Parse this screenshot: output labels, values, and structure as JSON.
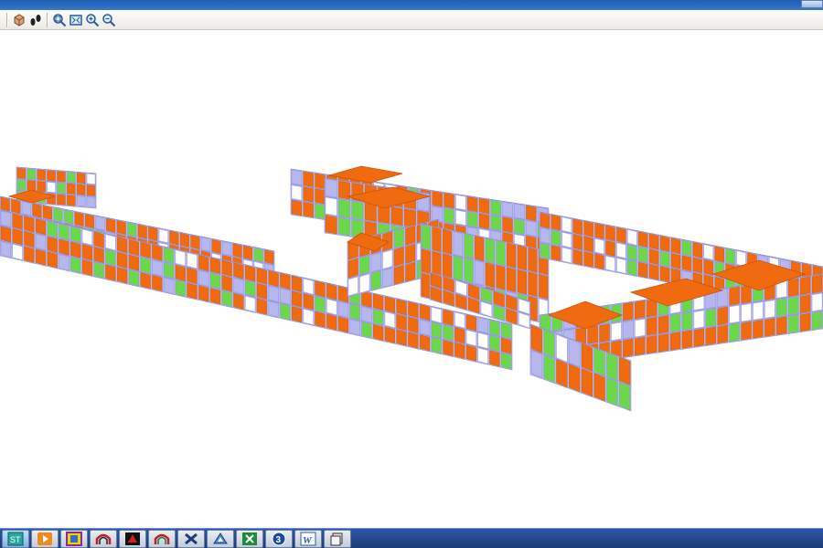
{
  "window": {
    "accent_color": "#2b6cc4"
  },
  "toolbar": {
    "items": [
      {
        "icon": "model-view-icon"
      },
      {
        "icon": "walk-icon"
      },
      {
        "icon": "zoom-window-icon"
      },
      {
        "icon": "zoom-extents-icon"
      },
      {
        "icon": "zoom-in-icon"
      },
      {
        "icon": "zoom-out-icon"
      }
    ]
  },
  "model": {
    "colors": {
      "wall": "#f06a10",
      "wall_dark": "#c95408",
      "slab": "#b7b7f0",
      "slab_edge": "#8e8ed8",
      "opening": "#6bd84a",
      "void": "#ffffff"
    }
  },
  "taskbar": {
    "items": [
      {
        "icon": "structure-app-icon"
      },
      {
        "icon": "media-player-icon"
      },
      {
        "icon": "design-app-icon"
      },
      {
        "icon": "arch-app-icon"
      },
      {
        "icon": "cad-app-icon"
      },
      {
        "icon": "arch-app-2-icon"
      },
      {
        "icon": "tools-app-icon"
      },
      {
        "icon": "survey-app-icon"
      },
      {
        "icon": "excel-icon"
      },
      {
        "icon": "three-app-icon"
      },
      {
        "icon": "word-icon"
      },
      {
        "icon": "file-manager-icon"
      }
    ]
  }
}
